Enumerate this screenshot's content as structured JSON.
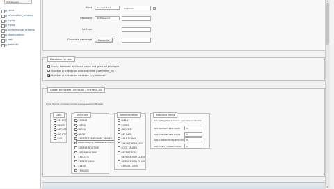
{
  "sidebar": {
    "db_select_value": "(Databases)...",
    "databases": [
      "cdcol",
      "information_schema",
      "mysql",
      "mysql",
      "performance_schema",
      "phpmyadmin",
      "test",
      "webauth"
    ]
  },
  "login": {
    "host_label": "Host",
    "host_select": "Use text field",
    "host_value": "localhost",
    "password_label": "Password",
    "password_select": "No Password",
    "retype_label": "Re-type",
    "generate_label": "Generate password",
    "generate_button": "Generate"
  },
  "database_for_user": {
    "legend": "Database for user",
    "options": [
      {
        "label": "Create database with same name and grant all privileges",
        "checked": false
      },
      {
        "label": "Grant all privileges on wildcard name (username\\_%)",
        "checked": false
      },
      {
        "label": "Grant all privileges on database \"mydatabase\"",
        "checked": true
      }
    ]
  },
  "global_privileges": {
    "legend": "Global privileges (Check All / Uncheck All)",
    "note": "Note: MySQL privilege names are expressed in English",
    "data": {
      "legend": "Data",
      "items": [
        {
          "label": "SELECT",
          "checked": true
        },
        {
          "label": "INSERT",
          "checked": true
        },
        {
          "label": "UPDATE",
          "checked": true
        },
        {
          "label": "DELETE",
          "checked": true
        },
        {
          "label": "FILE",
          "checked": false
        }
      ]
    },
    "structure": {
      "legend": "Structure",
      "items": [
        {
          "label": "CREATE",
          "checked": true
        },
        {
          "label": "ALTER",
          "checked": true
        },
        {
          "label": "INDEX",
          "checked": true
        },
        {
          "label": "DROP",
          "checked": true
        },
        {
          "label": "CREATE TEMPORARY TABLES",
          "checked": false
        },
        {
          "label": "SHOW VIEW",
          "checked": false
        },
        {
          "label": "CREATE ROUTINE",
          "checked": false
        },
        {
          "label": "ALTER ROUTINE",
          "checked": false
        },
        {
          "label": "EXECUTE",
          "checked": false
        },
        {
          "label": "CREATE VIEW",
          "checked": false
        },
        {
          "label": "EVENT",
          "checked": false
        },
        {
          "label": "TRIGGER",
          "checked": false
        }
      ],
      "tooltip": "Allows dropping databases and tables."
    },
    "administration": {
      "legend": "Administration",
      "items": [
        {
          "label": "GRANT",
          "checked": false
        },
        {
          "label": "SUPER",
          "checked": false
        },
        {
          "label": "PROCESS",
          "checked": false
        },
        {
          "label": "RELOAD",
          "checked": false
        },
        {
          "label": "SHUTDOWN",
          "checked": false
        },
        {
          "label": "SHOW DATABASES",
          "checked": false
        },
        {
          "label": "LOCK TABLES",
          "checked": false
        },
        {
          "label": "REFERENCES",
          "checked": false
        },
        {
          "label": "REPLICATION CLIENT",
          "checked": false
        },
        {
          "label": "REPLICATION SLAVE",
          "checked": false
        },
        {
          "label": "CREATE USER",
          "checked": false
        }
      ]
    },
    "resource_limits": {
      "legend": "Resource limits",
      "note": "Note: Setting these options to 0 (zero) removes the limit.",
      "items": [
        {
          "label": "MAX QUERIES PER HOUR",
          "value": "0"
        },
        {
          "label": "MAX UPDATES PER HOUR",
          "value": "0"
        },
        {
          "label": "MAX CONNECTIONS PER HOUR",
          "value": "0"
        },
        {
          "label": "MAX USER_CONNECTIONS",
          "value": "0"
        }
      ]
    }
  }
}
